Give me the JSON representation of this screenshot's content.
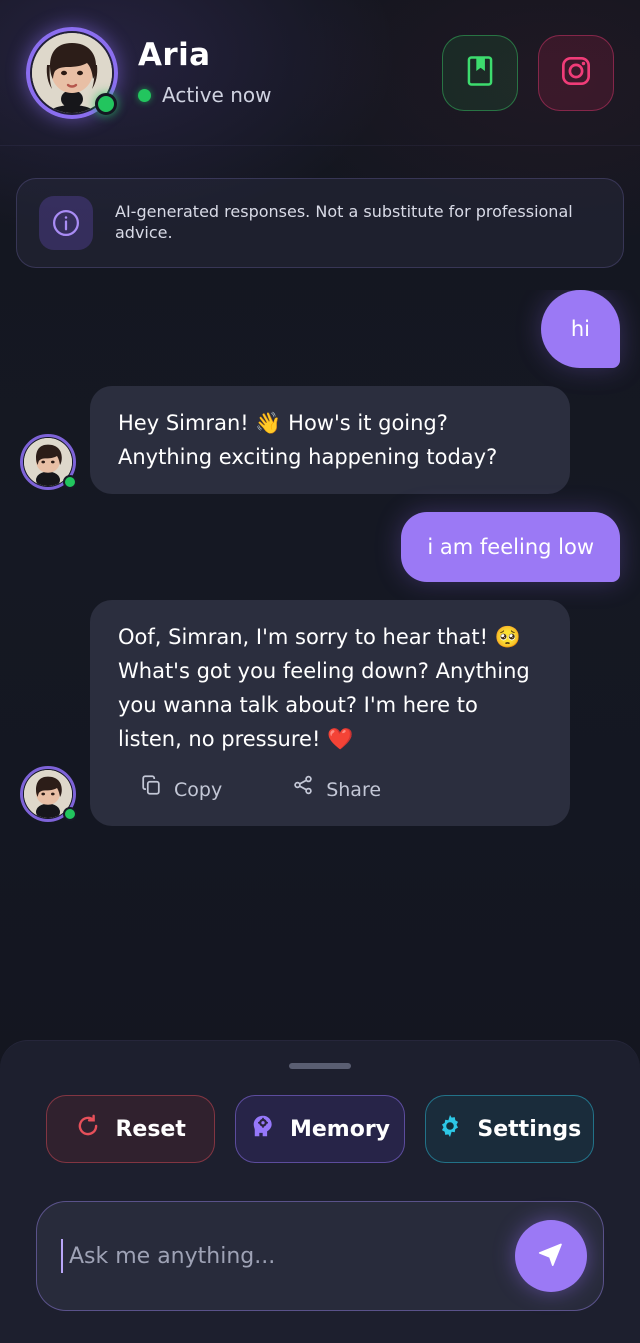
{
  "header": {
    "name": "Aria",
    "status": "Active now",
    "status_icon": "online-dot-icon",
    "avatar_icon": "avatar-portrait",
    "actions": [
      {
        "name": "journal-button",
        "icon": "bookmark-icon",
        "color": "#3ddc6e"
      },
      {
        "name": "instagram-button",
        "icon": "instagram-icon",
        "color": "#f03c78"
      }
    ]
  },
  "disclaimer": {
    "icon": "info-icon",
    "text": "AI-generated responses. Not a substitute for professional advice."
  },
  "chat": {
    "messages": [
      {
        "sender": "user",
        "text": "hi"
      },
      {
        "sender": "ai",
        "text": "Hey Simran! 👋 How's it going? Anything exciting happening today?"
      },
      {
        "sender": "user",
        "text": "i am feeling low"
      },
      {
        "sender": "ai",
        "text": "Oof, Simran, I'm sorry to hear that! 🥺 What's got you feeling down? Anything you wanna talk about? I'm here to listen, no pressure! ❤️"
      }
    ],
    "actions": {
      "copy_label": "Copy",
      "copy_icon": "copy-icon",
      "share_label": "Share",
      "share_icon": "share-icon"
    }
  },
  "bottom": {
    "drag_handle": "drag-handle",
    "quick_actions": [
      {
        "label": "Reset",
        "icon": "refresh-icon",
        "color": "#e6505a"
      },
      {
        "label": "Memory",
        "icon": "brain-gear-icon",
        "color": "#9678fa"
      },
      {
        "label": "Settings",
        "icon": "gear-icon",
        "color": "#2dc8e6"
      }
    ],
    "input": {
      "placeholder": "Ask me anything...",
      "value": "",
      "send_icon": "send-icon"
    }
  },
  "colors": {
    "background": "#151823",
    "accent": "#9b79f5",
    "ai_bubble": "#2b2e3e",
    "online": "#22c55e",
    "panel": "#1d1f2e"
  }
}
